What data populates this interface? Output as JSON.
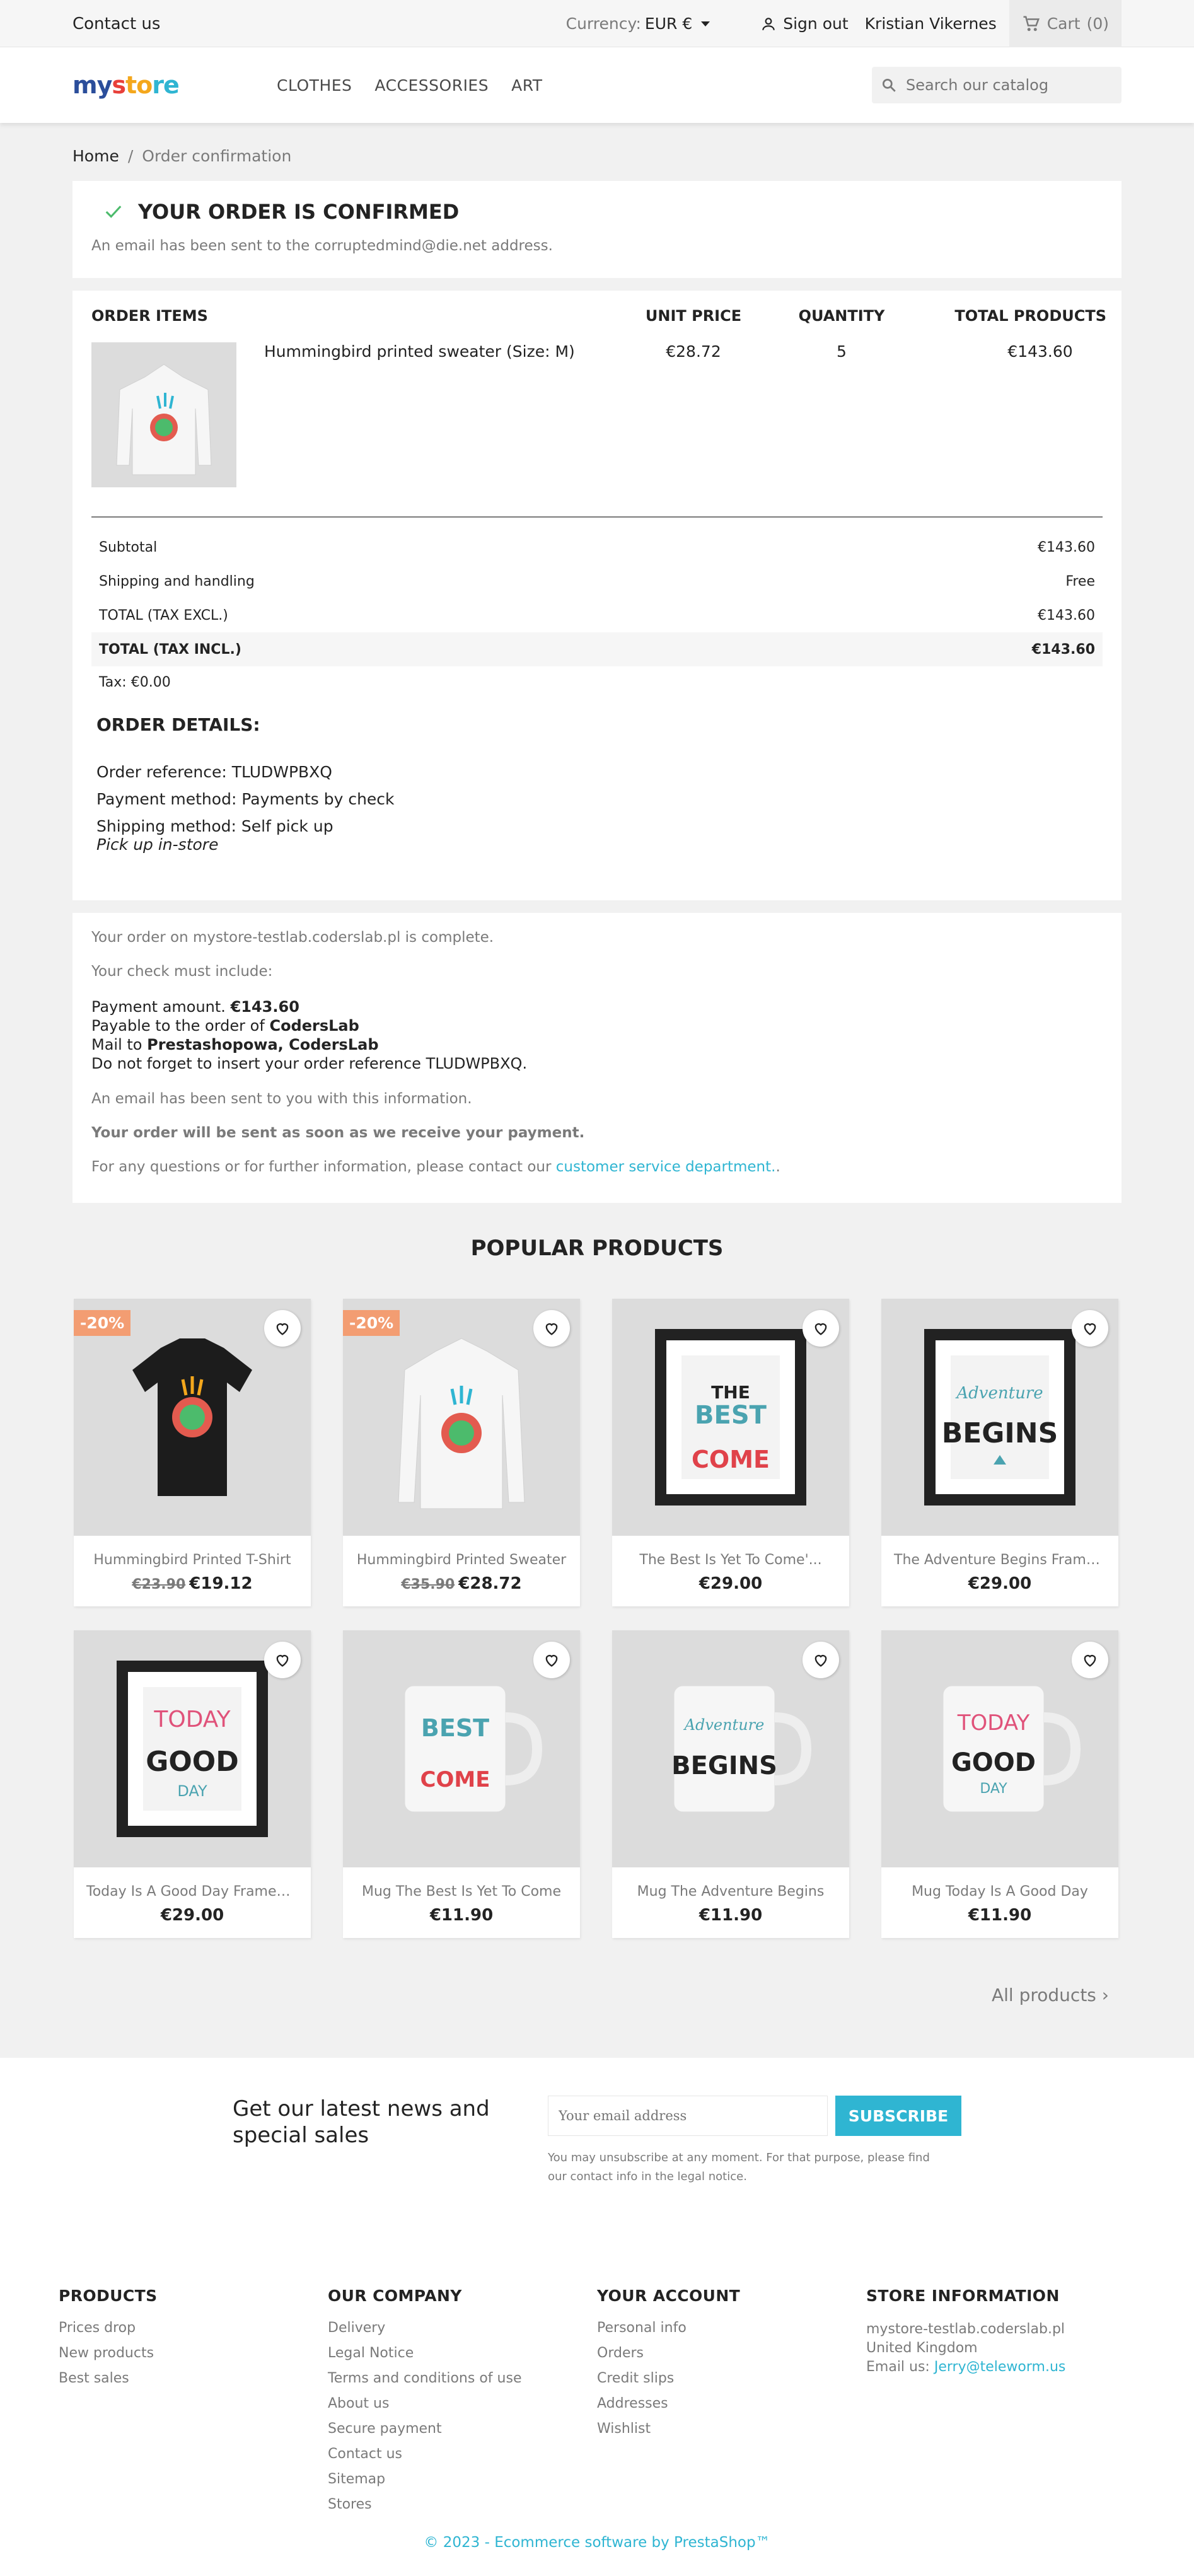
{
  "topnav": {
    "contact": "Contact us",
    "currency_label": "Currency:",
    "currency_value": "EUR €",
    "signout": "Sign out",
    "username": "Kristian Vikernes",
    "cart": "Cart",
    "cart_count": "(0)"
  },
  "header": {
    "logo": {
      "m": "my",
      "s1": "s",
      "s2": "to",
      "s3": "re"
    },
    "menu": [
      "CLOTHES",
      "ACCESSORIES",
      "ART"
    ],
    "search_placeholder": "Search our catalog"
  },
  "breadcrumb": {
    "home": "Home",
    "separator": "/",
    "current": "Order confirmation"
  },
  "confirmation": {
    "title": "YOUR ORDER IS CONFIRMED",
    "email_note": "An email has been sent to the corruptedmind@die.net address."
  },
  "items": {
    "headers": [
      "ORDER ITEMS",
      "UNIT PRICE",
      "QUANTITY",
      "TOTAL PRODUCTS"
    ],
    "rows": [
      {
        "name": "Hummingbird printed sweater (Size: M)",
        "unit_price": "€28.72",
        "quantity": "5",
        "total": "€143.60"
      }
    ]
  },
  "totals": {
    "subtotal_label": "Subtotal",
    "subtotal": "€143.60",
    "shipping_label": "Shipping and handling",
    "shipping": "Free",
    "excl_label": "TOTAL (TAX EXCL.)",
    "excl": "€143.60",
    "incl_label": "TOTAL (TAX INCL.)",
    "incl": "€143.60",
    "tax": "Tax: €0.00"
  },
  "details": {
    "title": "ORDER DETAILS:",
    "reference": "Order reference: TLUDWPBXQ",
    "payment": "Payment method: Payments by check",
    "shipping": "Shipping method: Self pick up",
    "pickup": "Pick up in-store"
  },
  "info": {
    "complete": "Your order on mystore-testlab.coderslab.pl is complete.",
    "check_include": "Your check must include:",
    "amount_label": "Payment amount.",
    "amount": "€143.60",
    "payable_label": "Payable to the order of",
    "payable": "CodersLab",
    "mail_label": "Mail to",
    "mail": "Prestashopowa, CodersLab",
    "reference_note": "Do not forget to insert your order reference TLUDWPBXQ.",
    "email_sent": "An email has been sent to you with this information.",
    "sent_note": "Your order will be sent as soon as we receive your payment.",
    "questions": "For any questions or for further information, please contact our",
    "link": "customer service department."
  },
  "popular": {
    "title": "POPULAR PRODUCTS",
    "products": [
      {
        "name": "Hummingbird Printed T-Shirt",
        "old": "€23.90",
        "price": "€19.12",
        "badge": "-20%",
        "kind": "tshirt"
      },
      {
        "name": "Hummingbird Printed Sweater",
        "old": "€35.90",
        "price": "€28.72",
        "badge": "-20%",
        "kind": "sweater"
      },
      {
        "name": "The Best Is Yet To Come'...",
        "old": "",
        "price": "€29.00",
        "badge": "",
        "kind": "frame-best"
      },
      {
        "name": "The Adventure Begins Framed...",
        "old": "",
        "price": "€29.00",
        "badge": "",
        "kind": "frame-adv"
      },
      {
        "name": "Today Is A Good Day Framed...",
        "old": "",
        "price": "€29.00",
        "badge": "",
        "kind": "frame-today"
      },
      {
        "name": "Mug The Best Is Yet To Come",
        "old": "",
        "price": "€11.90",
        "badge": "",
        "kind": "mug-best"
      },
      {
        "name": "Mug The Adventure Begins",
        "old": "",
        "price": "€11.90",
        "badge": "",
        "kind": "mug-adv"
      },
      {
        "name": "Mug Today Is A Good Day",
        "old": "",
        "price": "€11.90",
        "badge": "",
        "kind": "mug-today"
      }
    ],
    "all_products": "All products"
  },
  "newsletter": {
    "title": "Get our latest news and special sales",
    "placeholder": "Your email address",
    "button": "SUBSCRIBE",
    "note": "You may unsubscribe at any moment. For that purpose, please find our contact info in the legal notice."
  },
  "footer": {
    "products": {
      "title": "PRODUCTS",
      "items": [
        "Prices drop",
        "New products",
        "Best sales"
      ]
    },
    "company": {
      "title": "OUR COMPANY",
      "items": [
        "Delivery",
        "Legal Notice",
        "Terms and conditions of use",
        "About us",
        "Secure payment",
        "Contact us",
        "Sitemap",
        "Stores"
      ]
    },
    "account": {
      "title": "YOUR ACCOUNT",
      "items": [
        "Personal info",
        "Orders",
        "Credit slips",
        "Addresses",
        "Wishlist"
      ]
    },
    "store": {
      "title": "STORE INFORMATION",
      "line1": "mystore-testlab.coderslab.pl",
      "line2": "United Kingdom",
      "email_label": "Email us:",
      "email": "Jerry@teleworm.us"
    },
    "copyright": "© 2023 - Ecommerce software by PrestaShop™"
  },
  "colors": {
    "accent": "#2fb5d2",
    "badge": "#f39d72",
    "check": "#4cbb6c"
  }
}
